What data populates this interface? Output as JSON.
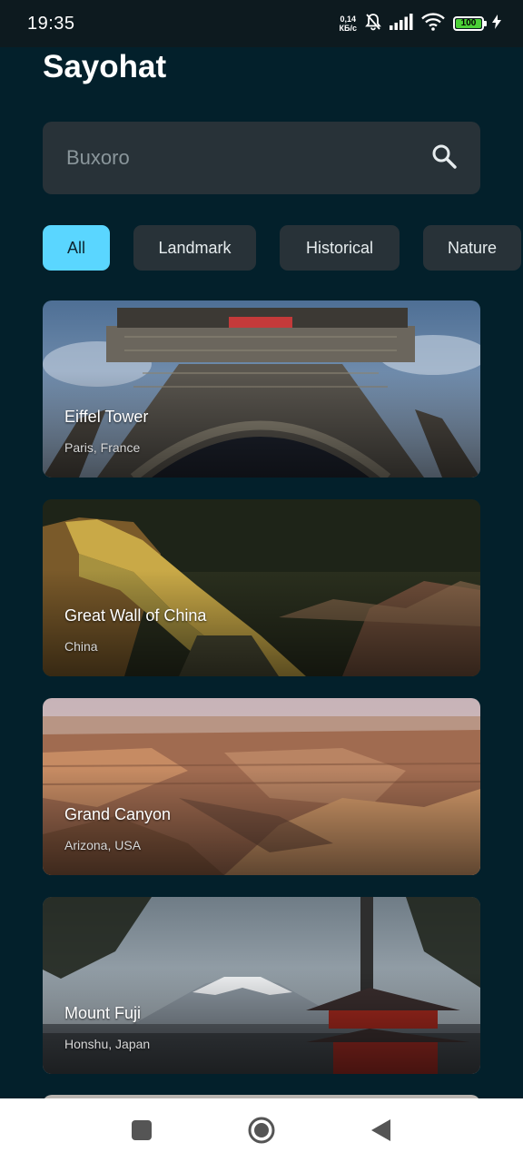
{
  "status_bar": {
    "time": "19:35",
    "net_speed_value": "0,14",
    "net_speed_unit": "КБ/с",
    "battery": "100"
  },
  "app": {
    "title": "Sayohat"
  },
  "search": {
    "placeholder": "Buxoro",
    "icon": "search-icon"
  },
  "filters": [
    {
      "label": "All",
      "active": true
    },
    {
      "label": "Landmark",
      "active": false
    },
    {
      "label": "Historical",
      "active": false
    },
    {
      "label": "Nature",
      "active": false
    }
  ],
  "places": [
    {
      "title": "Eiffel Tower",
      "subtitle": "Paris, France"
    },
    {
      "title": "Great Wall of China",
      "subtitle": "China"
    },
    {
      "title": "Grand Canyon",
      "subtitle": "Arizona, USA"
    },
    {
      "title": "Mount Fuji",
      "subtitle": "Honshu, Japan"
    }
  ],
  "nav": {
    "icons": [
      "recents-icon",
      "home-icon",
      "back-icon"
    ]
  }
}
